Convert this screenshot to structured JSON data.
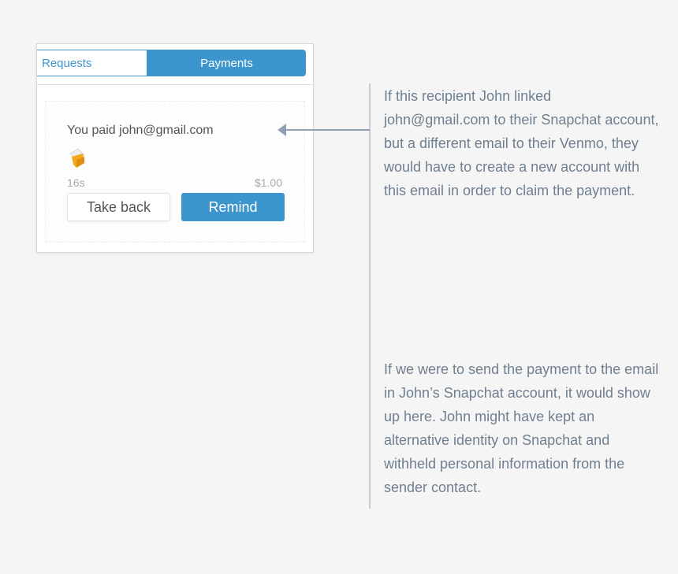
{
  "tabs": {
    "requests_label": "Requests",
    "payments_label": "Payments"
  },
  "payment_card": {
    "title": "You paid john@gmail.com",
    "emoji_icon": "beer-mug-icon",
    "time": "16s",
    "amount": "$1.00",
    "take_back_label": "Take back",
    "remind_label": "Remind"
  },
  "annotations": {
    "note_1": "If this recipient John linked john@gmail.com to their Snapchat account, but a different email to their Venmo, they would have to create a new account with this email in order to claim the payment.",
    "note_2": "If we were to send the payment to the email in John’s Snapchat account, it would show up here. John might have kept an alternative identity on Snapchat and withheld personal information from the sender contact."
  },
  "colors": {
    "accent": "#3d95ce",
    "annotation_text": "#6f7f90",
    "background": "#f5f5f5"
  }
}
